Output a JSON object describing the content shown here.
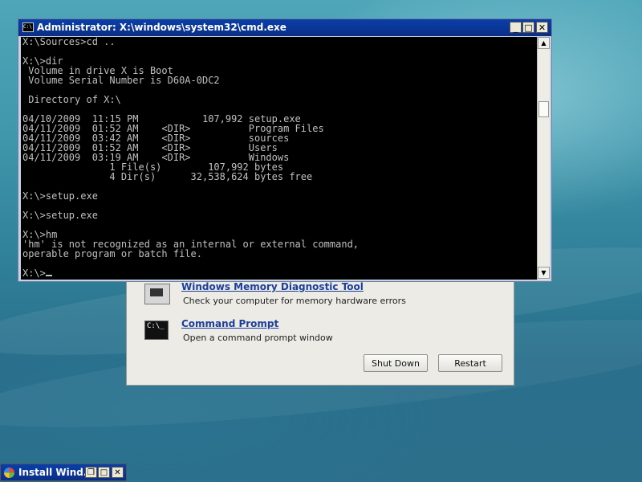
{
  "console_window": {
    "title": "Administrator: X:\\windows\\system32\\cmd.exe",
    "app_icon": "C:\\",
    "lines": [
      "X:\\Sources>cd ..",
      "",
      "X:\\>dir",
      " Volume in drive X is Boot",
      " Volume Serial Number is D60A-0DC2",
      "",
      " Directory of X:\\",
      "",
      "04/10/2009  11:15 PM           107,992 setup.exe",
      "04/11/2009  01:52 AM    <DIR>          Program Files",
      "04/11/2009  03:42 AM    <DIR>          sources",
      "04/11/2009  01:52 AM    <DIR>          Users",
      "04/11/2009  03:19 AM    <DIR>          Windows",
      "               1 File(s)        107,992 bytes",
      "               4 Dir(s)      32,538,624 bytes free",
      "",
      "X:\\>setup.exe",
      "",
      "X:\\>setup.exe",
      "",
      "X:\\>hm",
      "'hm' is not recognized as an internal or external command,",
      "operable program or batch file.",
      "",
      "X:\\>"
    ],
    "buttons": {
      "minimize": "_",
      "maximize": "□",
      "close": "✕"
    },
    "icons": {
      "scroll_up": "arrow-up-icon",
      "scroll_down": "arrow-down-icon"
    }
  },
  "recovery_panel": {
    "options": [
      {
        "title": "Windows Memory Diagnostic Tool",
        "description": "Check your computer for memory hardware errors",
        "icon": "memory-chip-icon"
      },
      {
        "title": "Command Prompt",
        "description": "Open a command prompt window",
        "icon": "cmd-icon",
        "icon_text": "C:\\_"
      }
    ],
    "shutdown_label": "Shut Down",
    "restart_label": "Restart"
  },
  "taskbar_window": {
    "title": "Install Wind...",
    "buttons": {
      "restore": "❐",
      "maximize": "□",
      "close": "✕"
    }
  },
  "colors": {
    "desktop": "#3f95aa",
    "titlebar": "#0b3a9e",
    "console_bg": "#000000",
    "console_text": "#c0c0c0",
    "link": "#1c3f9c"
  }
}
